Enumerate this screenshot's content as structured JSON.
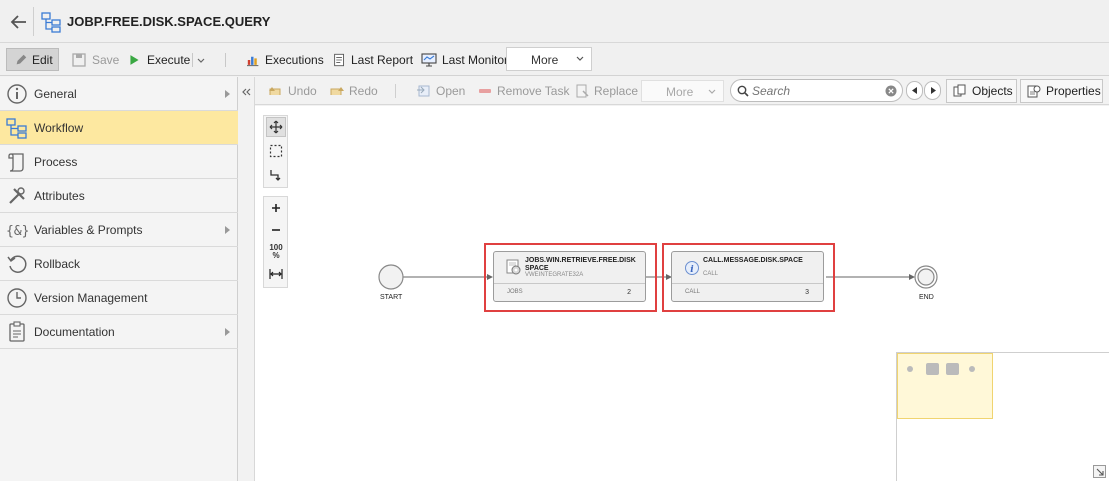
{
  "header": {
    "title": "JOBP.FREE.DISK.SPACE.QUERY"
  },
  "toolbar": {
    "edit": "Edit",
    "save": "Save",
    "execute": "Execute",
    "executions": "Executions",
    "last_report": "Last Report",
    "last_monitor": "Last Monitor",
    "more": "More"
  },
  "sidebar": {
    "items": [
      {
        "label": "General",
        "icon": "info-icon",
        "has_submenu": true
      },
      {
        "label": "Workflow",
        "icon": "workflow-icon",
        "has_submenu": false,
        "active": true
      },
      {
        "label": "Process",
        "icon": "scroll-icon",
        "has_submenu": false
      },
      {
        "label": "Attributes",
        "icon": "tools-icon",
        "has_submenu": false
      },
      {
        "label": "Variables & Prompts",
        "icon": "braces-icon",
        "has_submenu": true
      },
      {
        "label": "Rollback",
        "icon": "rollback-icon",
        "has_submenu": false
      },
      {
        "label": "Version Management",
        "icon": "clock-icon",
        "has_submenu": false
      },
      {
        "label": "Documentation",
        "icon": "document-icon",
        "has_submenu": true
      }
    ]
  },
  "workflow_toolbar": {
    "undo": "Undo",
    "redo": "Redo",
    "open": "Open",
    "remove_task": "Remove Task",
    "replace": "Replace",
    "more": "More",
    "search_placeholder": "Search",
    "objects": "Objects",
    "properties": "Properties"
  },
  "palette": {
    "zoom_100": "100",
    "zoom_percent": "%"
  },
  "workflow": {
    "start_label": "START",
    "end_label": "END",
    "tasks": [
      {
        "name": "JOBS.WIN.RETRIEVE.FREE.DISKSPACE",
        "agent": "VWEINTEGRATE32A",
        "type": "JOBS",
        "number": "2",
        "icon": "job-icon",
        "highlighted": true
      },
      {
        "name": "CALL.MESSAGE.DISK.SPACE",
        "agent": "CALL",
        "type": "CALL",
        "number": "3",
        "icon": "info-circle-icon",
        "highlighted": true
      }
    ]
  },
  "colors": {
    "active_sidebar": "#fde8a0",
    "highlight": "#e04040",
    "minimap_viewport": "#fff8d8"
  }
}
